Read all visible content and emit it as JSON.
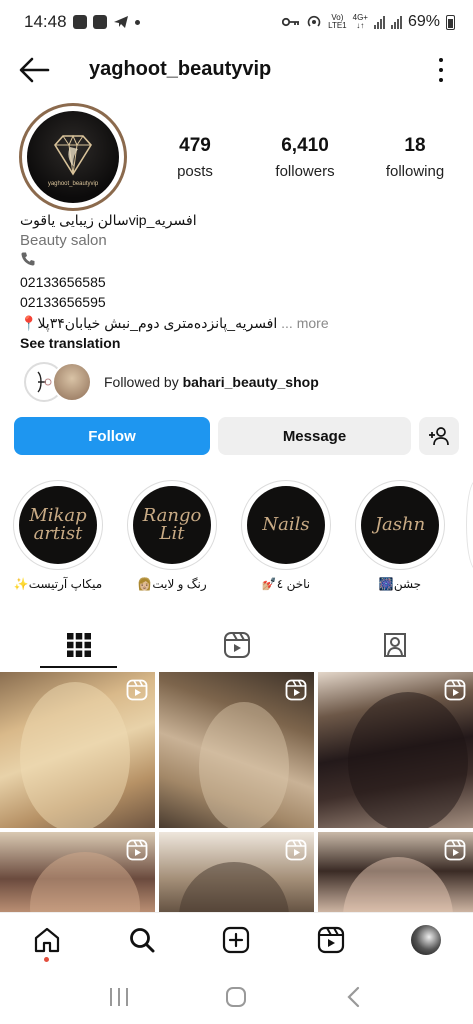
{
  "status_bar": {
    "time": "14:48",
    "network_label_top": "Vo)",
    "network_label_mid": "LTE1",
    "network_type": "4G+",
    "battery": "69%"
  },
  "header": {
    "username": "yaghoot_beautyvip"
  },
  "profile": {
    "avatar_text": "yaghoot_beautyvip",
    "stats": [
      {
        "value": "479",
        "label": "posts"
      },
      {
        "value": "6,410",
        "label": "followers"
      },
      {
        "value": "18",
        "label": "following"
      }
    ],
    "bio": {
      "name": "افسریه_vipسالن زیبایی یاقوت",
      "category": "Beauty salon",
      "phone_1": "02133656585",
      "phone_2": "02133656595",
      "address": "📍افسریه_پانزده‌متری دوم_نبش خیابان۳۴پلا",
      "more_label": "... more",
      "see_translation": "See translation"
    },
    "followed_by_prefix": "Followed by",
    "followed_by_user": "bahari_beauty_shop"
  },
  "actions": {
    "follow_label": "Follow",
    "message_label": "Message"
  },
  "highlights": [
    {
      "cover_text": "Mikap artist",
      "label": "میکاپ آرتیست✨"
    },
    {
      "cover_text": "Rango Lit",
      "label": "رنگ و لایت👩🏼"
    },
    {
      "cover_text": "Nails",
      "label": "ناخن ٤💅🏼"
    },
    {
      "cover_text": "Jashn",
      "label": "جشن🎆"
    }
  ],
  "tabs": [
    {
      "name": "grid",
      "icon": "grid-icon",
      "active": true
    },
    {
      "name": "reels",
      "icon": "reels-icon",
      "active": false
    },
    {
      "name": "tagged",
      "icon": "tagged-icon",
      "active": false
    }
  ],
  "posts": [
    {
      "type": "reel"
    },
    {
      "type": "reel"
    },
    {
      "type": "reel"
    },
    {
      "type": "reel"
    },
    {
      "type": "reel"
    },
    {
      "type": "reel"
    }
  ],
  "bottom_nav": [
    "home-icon",
    "search-icon",
    "create-icon",
    "reels-icon",
    "profile-avatar"
  ],
  "colors": {
    "follow_button": "#1e96f0",
    "secondary_button": "#efefef",
    "avatar_ring": "#8b6a4d",
    "highlight_text": "#c9ab85"
  }
}
